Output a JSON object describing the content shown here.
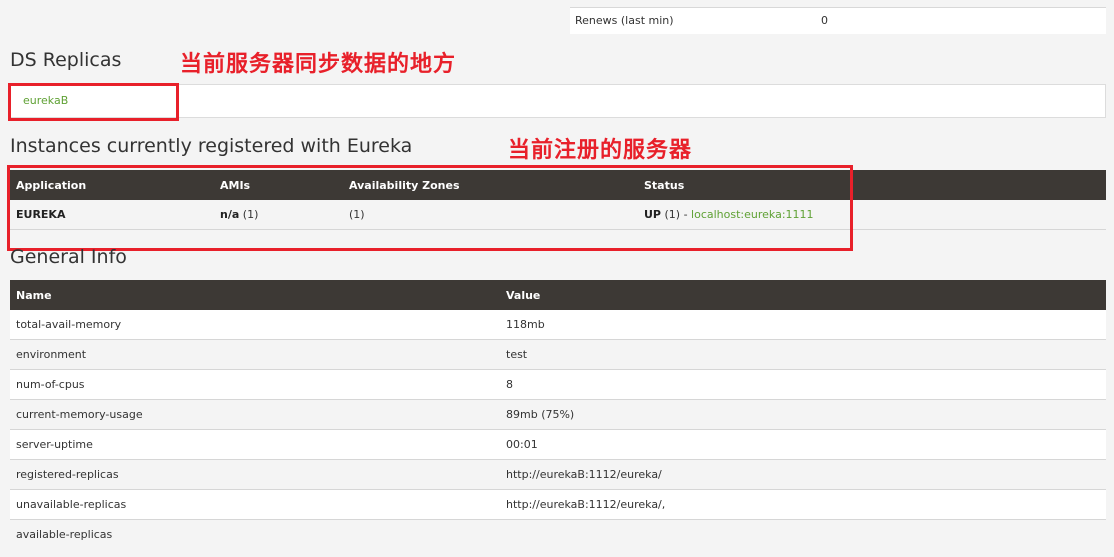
{
  "renews": {
    "label": "Renews (last min)",
    "value": "0"
  },
  "ds_replicas": {
    "title": "DS Replicas",
    "annotation": "当前服务器同步数据的地方",
    "replica": "eurekaB"
  },
  "instances": {
    "title": "Instances currently registered with Eureka",
    "annotation": "当前注册的服务器",
    "headers": {
      "application": "Application",
      "amis": "AMIs",
      "zones": "Availability Zones",
      "status": "Status"
    },
    "row": {
      "application": "EUREKA",
      "amis_bold": "n/a",
      "amis_count": " (1)",
      "zones": "(1)",
      "status_bold": "UP",
      "status_count": " (1) - ",
      "status_link": "localhost:eureka:1111"
    }
  },
  "general_info": {
    "title": "General Info",
    "headers": {
      "name": "Name",
      "value": "Value"
    },
    "rows": [
      {
        "name": "total-avail-memory",
        "value": "118mb"
      },
      {
        "name": "environment",
        "value": "test"
      },
      {
        "name": "num-of-cpus",
        "value": "8"
      },
      {
        "name": "current-memory-usage",
        "value": "89mb (75%)"
      },
      {
        "name": "server-uptime",
        "value": "00:01"
      },
      {
        "name": "registered-replicas",
        "value": "http://eurekaB:1112/eureka/"
      },
      {
        "name": "unavailable-replicas",
        "value": "http://eurekaB:1112/eureka/,"
      },
      {
        "name": "available-replicas",
        "value": ""
      }
    ]
  },
  "colors": {
    "header_bg": "#3d3935",
    "link": "#5fa134",
    "annotation": "#e8202a"
  }
}
